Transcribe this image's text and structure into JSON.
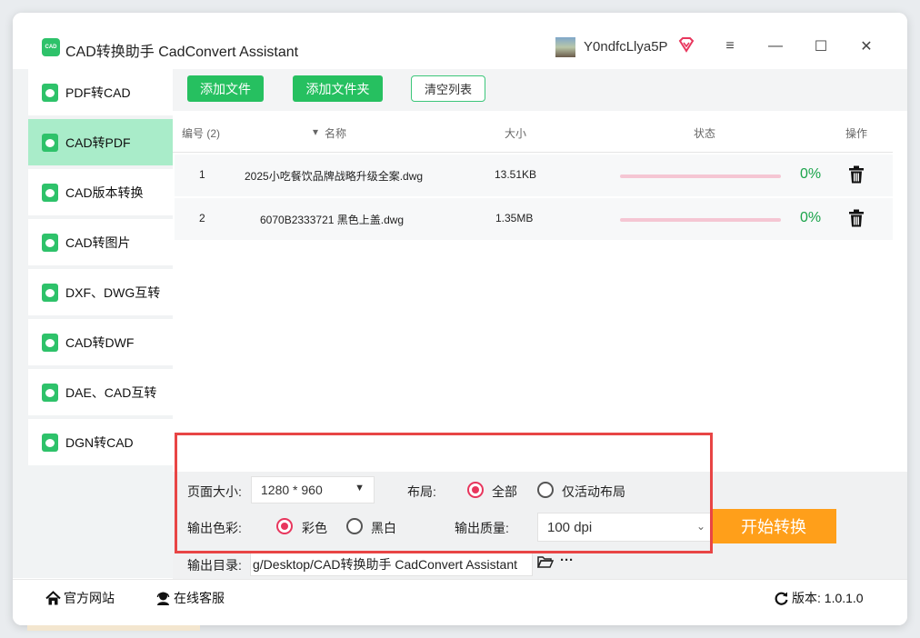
{
  "app": {
    "logo_text": "CAD",
    "title": "CAD转换助手 CadConvert Assistant",
    "username": "Y0ndfcLlya5P",
    "accent_color": "#26c060"
  },
  "window_controls": {
    "menu": "≡",
    "minimize": "—",
    "maximize": "☐",
    "close": "✕"
  },
  "sidebar": {
    "items": [
      {
        "label": "PDF转CAD",
        "active": false
      },
      {
        "label": "CAD转PDF",
        "active": true
      },
      {
        "label": "CAD版本转换",
        "active": false
      },
      {
        "label": "CAD转图片",
        "active": false
      },
      {
        "label": "DXF、DWG互转",
        "active": false
      },
      {
        "label": "CAD转DWF",
        "active": false
      },
      {
        "label": "DAE、CAD互转",
        "active": false
      },
      {
        "label": "DGN转CAD",
        "active": false
      }
    ]
  },
  "toolbar": {
    "add_file": "添加文件",
    "add_folder": "添加文件夹",
    "clear_list": "清空列表"
  },
  "table": {
    "headers": {
      "index": "编号 (2)",
      "name": "名称",
      "size": "大小",
      "status": "状态",
      "action": "操作"
    },
    "rows": [
      {
        "index": "1",
        "name": "2025小吃餐饮品牌战略升级全案.dwg",
        "size": "13.51KB",
        "progress": 0,
        "progress_label": "0%"
      },
      {
        "index": "2",
        "name": "6070B2333721 黑色上盖.dwg",
        "size": "1.35MB",
        "progress": 0,
        "progress_label": "0%"
      }
    ]
  },
  "settings": {
    "page_size_label": "页面大小:",
    "page_size_value": "1280 * 960",
    "layout_label": "布局:",
    "layout_options": [
      "全部",
      "仅活动布局"
    ],
    "layout_selected": "全部",
    "color_label": "输出色彩:",
    "color_options": [
      "彩色",
      "黑白"
    ],
    "color_selected": "彩色",
    "quality_label": "输出质量:",
    "quality_value": "100 dpi",
    "start_button": "开始转换",
    "output_dir_label": "输出目录:",
    "output_dir_value": "g/Desktop/CAD转换助手 CadConvert Assistant",
    "more": "···"
  },
  "statusbar": {
    "website": "官方网站",
    "support": "在线客服",
    "version": "版本: 1.0.1.0"
  }
}
